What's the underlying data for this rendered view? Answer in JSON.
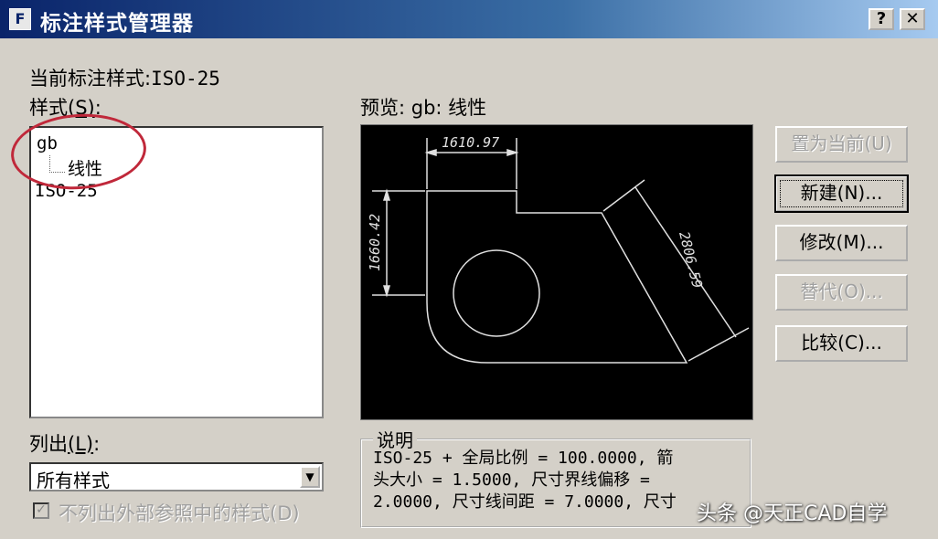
{
  "window": {
    "title": "标注样式管理器",
    "help_label": "?",
    "close_label": "✕"
  },
  "current_style": {
    "label": "当前标注样式:",
    "value": "ISO-25"
  },
  "styles": {
    "label": "样式",
    "mnemonic": "(S)",
    "label_suffix": ":",
    "items": [
      {
        "name": "gb"
      },
      {
        "name": "线性"
      },
      {
        "name": "ISO-25"
      }
    ]
  },
  "preview": {
    "label": "预览: gb: 线性",
    "dims": {
      "top": "1610.97",
      "left": "1660.42",
      "diag": "2806.59"
    }
  },
  "buttons": {
    "set_current": "置为当前(U)",
    "new": "新建(N)...",
    "modify": "修改(M)...",
    "override": "替代(O)...",
    "compare": "比较(C)..."
  },
  "list_out": {
    "label": "列出",
    "mnemonic": "(L)",
    "label_suffix": ":",
    "selected": "所有样式"
  },
  "exclude_xref": {
    "label": "不列出外部参照中的样式(D)",
    "checked": true
  },
  "description": {
    "legend": "说明",
    "lines": [
      "ISO-25 + 全局比例 = 100.0000, 箭",
      "头大小 = 1.5000, 尺寸界线偏移 =",
      "2.0000, 尺寸线间距 = 7.0000, 尺寸"
    ]
  },
  "watermark": "头条 @天正CAD自学"
}
